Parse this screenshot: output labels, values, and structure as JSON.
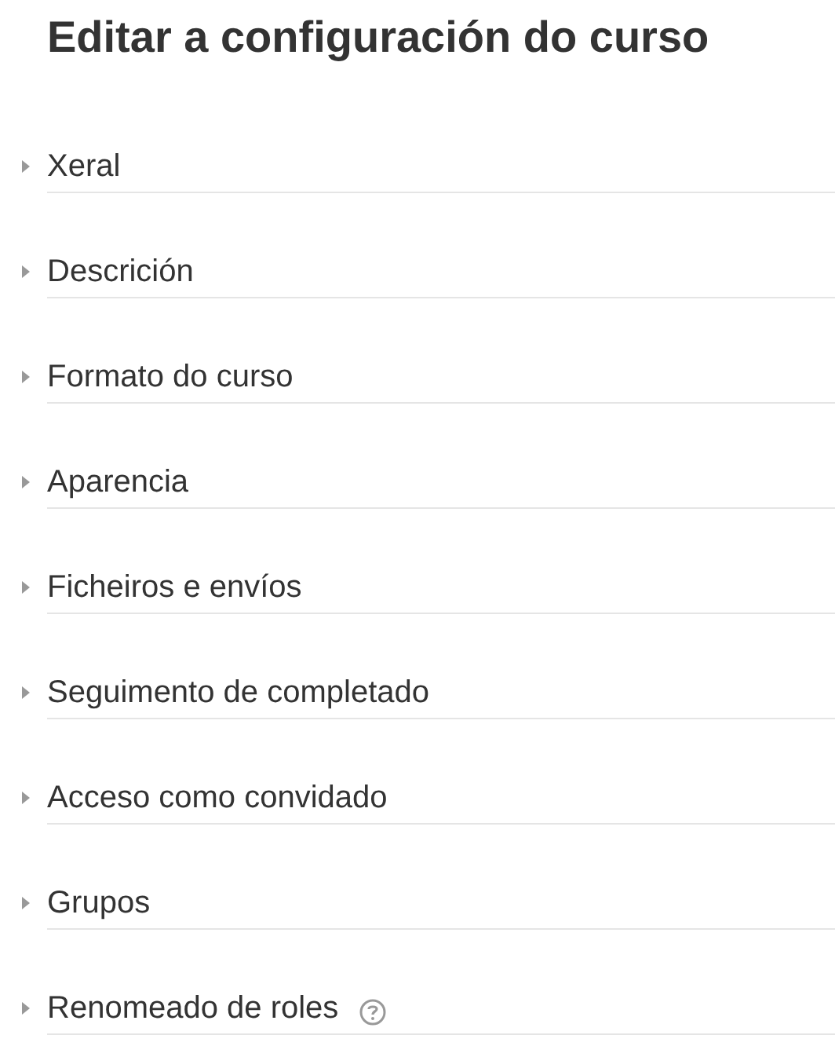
{
  "title": "Editar a configuración do curso",
  "sections": [
    {
      "label": "Xeral",
      "expanded": false,
      "help": false
    },
    {
      "label": "Descrición",
      "expanded": false,
      "help": false
    },
    {
      "label": "Formato do curso",
      "expanded": false,
      "help": false
    },
    {
      "label": "Aparencia",
      "expanded": false,
      "help": false
    },
    {
      "label": "Ficheiros e envíos",
      "expanded": false,
      "help": false
    },
    {
      "label": "Seguimento de completado",
      "expanded": false,
      "help": false
    },
    {
      "label": "Acceso como convidado",
      "expanded": false,
      "help": false
    },
    {
      "label": "Grupos",
      "expanded": false,
      "help": false
    },
    {
      "label": "Renomeado de roles",
      "expanded": false,
      "help": true
    }
  ]
}
